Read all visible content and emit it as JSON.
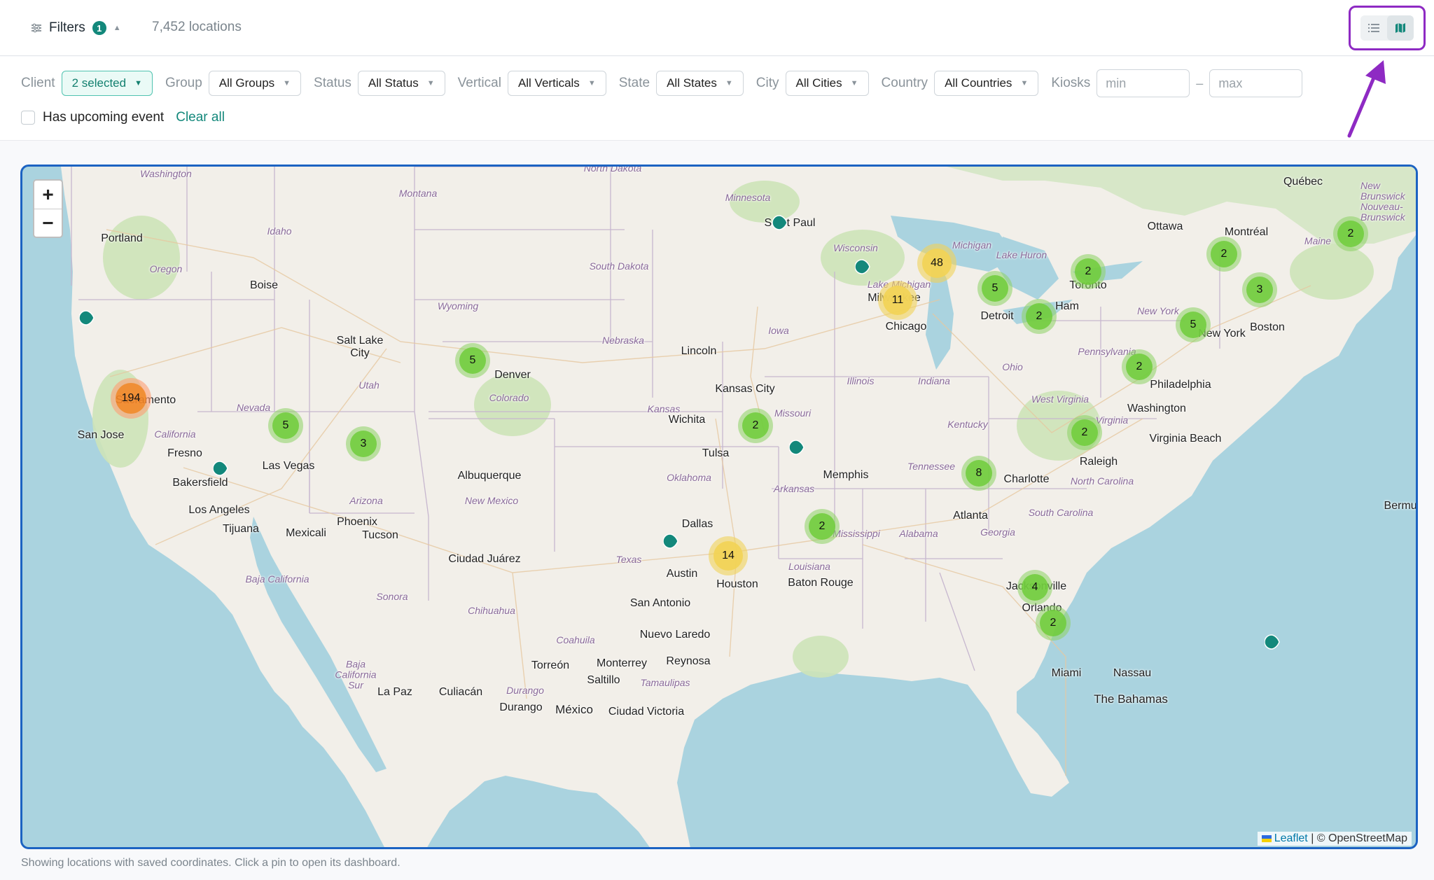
{
  "header": {
    "filters_label": "Filters",
    "filters_badge": "1",
    "locations_count": "7,452 locations"
  },
  "filters": {
    "client": {
      "label": "Client",
      "value": "2 selected"
    },
    "group": {
      "label": "Group",
      "value": "All Groups"
    },
    "status": {
      "label": "Status",
      "value": "All Status"
    },
    "vertical": {
      "label": "Vertical",
      "value": "All Verticals"
    },
    "state": {
      "label": "State",
      "value": "All States"
    },
    "city": {
      "label": "City",
      "value": "All Cities"
    },
    "country": {
      "label": "Country",
      "value": "All Countries"
    },
    "kiosks": {
      "label": "Kiosks",
      "min_placeholder": "min",
      "max_placeholder": "max",
      "separator": "–"
    },
    "upcoming_event_label": "Has upcoming event",
    "clear_all": "Clear all"
  },
  "map": {
    "zoom_in": "+",
    "zoom_out": "−",
    "attribution_leaflet": "Leaflet",
    "attribution_osm": "| © OpenStreetMap",
    "clusters": [
      "194",
      "48",
      "11",
      "14",
      "8",
      "5",
      "5",
      "5",
      "5",
      "3",
      "3",
      "2",
      "2",
      "2",
      "2",
      "2",
      "2",
      "2",
      "2",
      "4",
      "2"
    ],
    "cities": [
      "Washington",
      "Montana",
      "Minnesota",
      "Québec",
      "Portland",
      "Idaho",
      "Oregon",
      "Boise",
      "South Dakota",
      "Wisconsin",
      "Michigan",
      "Lake Huron",
      "Ottawa",
      "Montréal",
      "Maine",
      "New Brunswick Nouveau-Brunswick",
      "Wyoming",
      "Toronto",
      "Ham",
      "New York",
      "Salt Lake City",
      "Nebraska",
      "Lincoln",
      "Iowa",
      "Chicago",
      "Detroit",
      "Lake Michigan",
      "Milwaukee",
      "Boston",
      "Utah",
      "Denver",
      "Colorado",
      "Illinois",
      "Indiana",
      "Ohio",
      "Pennsylvania",
      "Philadelphia",
      "Sacramento",
      "Nevada",
      "Kansas City",
      "Missouri",
      "Kansas",
      "Wichita",
      "West Virginia",
      "Washington",
      "Kentucky",
      "Virginia",
      "Virginia Beach",
      "San Jose",
      "California",
      "Fresno",
      "Tulsa",
      "Memphis",
      "Tennessee",
      "Raleigh",
      "Charlotte",
      "North Carolina",
      "Las Vegas",
      "Albuquerque",
      "Oklahoma",
      "Arkansas",
      "Bakersfield",
      "Arizona",
      "New Mexico",
      "Los Angeles",
      "Phoenix",
      "Tijuana",
      "Mexicali",
      "Tucson",
      "Dallas",
      "Mississippi",
      "Alabama",
      "Atlanta",
      "Georgia",
      "South Carolina",
      "Ciudad Juárez",
      "Texas",
      "Louisiana",
      "Baton Rouge",
      "Baja California",
      "Sonora",
      "Austin",
      "Houston",
      "San Antonio",
      "Jacksonville",
      "Chihuahua",
      "Orlando",
      "Coahuila",
      "Nuevo Laredo",
      "Torreón",
      "Monterrey",
      "Reynosa",
      "Baja California Sur",
      "Saltillo",
      "Tamaulipas",
      "Miami",
      "Nassau",
      "The Bahamas",
      "La Paz",
      "Culiacán",
      "Durango",
      "Durango",
      "México",
      "Ciudad Victoria",
      "Bermuda",
      "North Dakota",
      "Saint Paul",
      "New York"
    ]
  },
  "footnote": "Showing locations with saved coordinates. Click a pin to open its dashboard."
}
